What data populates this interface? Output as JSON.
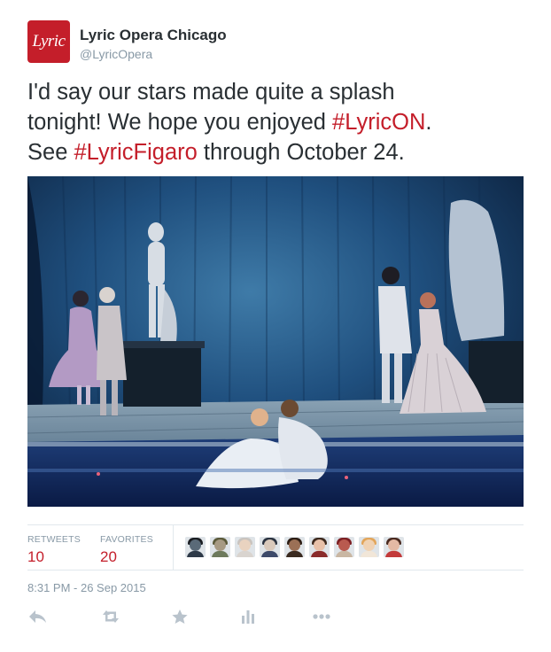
{
  "account": {
    "avatar_text": "Lyric",
    "name": "Lyric Opera Chicago",
    "handle": "@LyricOpera"
  },
  "tweet": {
    "line1": "I'd say our stars made quite a splash",
    "line2_pre": "tonight! We hope you enjoyed ",
    "hashtag1": "#LyricON",
    "line2_post": ".",
    "line3_pre": "See ",
    "hashtag2": "#LyricFigaro",
    "line3_post": " through October 24."
  },
  "stats": {
    "retweets_label": "RETWEETS",
    "retweets_count": "10",
    "favorites_label": "FAVORITES",
    "favorites_count": "20"
  },
  "favoriters": [
    {
      "skin": "#5a6a78",
      "hair": "#1a1d22",
      "shirt": "#2e3a48"
    },
    {
      "skin": "#a79a83",
      "hair": "#5b5a3a",
      "shirt": "#6d7a5c"
    },
    {
      "skin": "#e9d3c0",
      "hair": "#c9c4bf",
      "shirt": "#d9d4cf"
    },
    {
      "skin": "#d9c9bb",
      "hair": "#2b3340",
      "shirt": "#3d4a6a"
    },
    {
      "skin": "#9b7056",
      "hair": "#2c1d14",
      "shirt": "#3a2a20"
    },
    {
      "skin": "#e8c1a9",
      "hair": "#3e2a1e",
      "shirt": "#8a2b2b"
    },
    {
      "skin": "#b95a4f",
      "hair": "#7c1f23",
      "shirt": "#c9b7a3"
    },
    {
      "skin": "#f0d2b3",
      "hair": "#e2a55a",
      "shirt": "#f1e6d8"
    },
    {
      "skin": "#e4b9a4",
      "hair": "#4a2a20",
      "shirt": "#c33a3a"
    }
  ],
  "timestamp": "8:31 PM - 26 Sep 2015",
  "actions": [
    "reply-icon",
    "retweet-icon",
    "favorite-icon",
    "analytics-icon",
    "more-icon"
  ],
  "colors": {
    "brand": "#c41e2a",
    "muted": "#8899a6",
    "action": "#b9c3cc"
  }
}
